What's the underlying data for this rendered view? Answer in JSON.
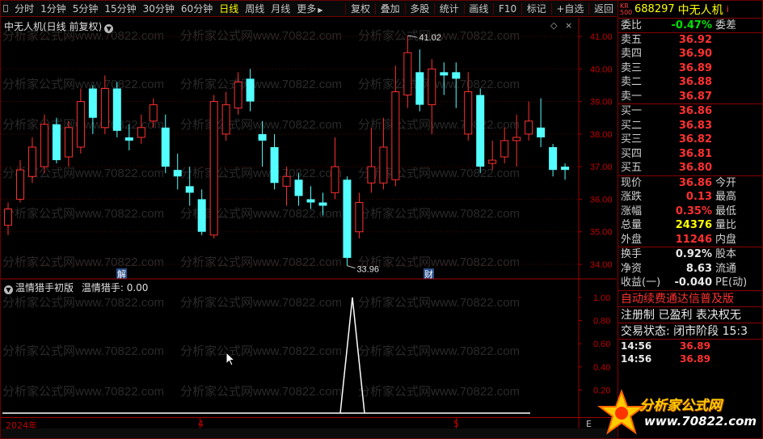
{
  "toolbar": {
    "periods": [
      "分时",
      "1分钟",
      "5分钟",
      "15分钟",
      "30分钟",
      "60分钟",
      "日线",
      "周线",
      "月线",
      "更多"
    ],
    "active_period": "日线",
    "more_icon": "triangle-right-icon",
    "actions": [
      "复权",
      "叠加",
      "多股",
      "统计",
      "画线",
      "F10",
      "标记",
      "+自选",
      "返回"
    ]
  },
  "main_chart": {
    "title": "中无人机(日线 前复权)",
    "high_label": "41.02",
    "low_label": "33.96",
    "price_ticks": [
      "41.00",
      "40.00",
      "39.00",
      "38.00",
      "37.00",
      "36.00",
      "35.00",
      "34.00"
    ],
    "markers": [
      "解",
      "财"
    ],
    "watermark": "分析家公式网www.70822.com"
  },
  "indicator": {
    "title": "温情猎手初版",
    "series_label": "温情猎手:",
    "series_value": "0.00",
    "ticks": [
      "1.00",
      "0.80",
      "0.60",
      "0.40",
      "0.20"
    ]
  },
  "time_axis": {
    "labels": [
      "2024年",
      "4",
      "5"
    ],
    "end_label": "E"
  },
  "quote": {
    "exchange_badge": "KR\n500",
    "code": "688297",
    "name": "中无人机",
    "info_icon": "i",
    "weibi": {
      "label": "委比",
      "value": "-0.47%",
      "label2": "委差"
    },
    "asks": [
      {
        "label": "卖五",
        "price": "36.92"
      },
      {
        "label": "卖四",
        "price": "36.90"
      },
      {
        "label": "卖三",
        "price": "36.89"
      },
      {
        "label": "卖二",
        "price": "36.88"
      },
      {
        "label": "卖一",
        "price": "36.87"
      }
    ],
    "bids": [
      {
        "label": "买一",
        "price": "36.86"
      },
      {
        "label": "买二",
        "price": "36.83"
      },
      {
        "label": "买三",
        "price": "36.82"
      },
      {
        "label": "买四",
        "price": "36.81"
      },
      {
        "label": "买五",
        "price": "36.80"
      }
    ],
    "stats": [
      {
        "label": "现价",
        "value": "36.86",
        "label2": "今开"
      },
      {
        "label": "涨跌",
        "value": "0.13",
        "label2": "最高"
      },
      {
        "label": "涨幅",
        "value": "0.35%",
        "label2": "最低"
      },
      {
        "label": "总量",
        "value": "24376",
        "label2": "量比"
      },
      {
        "label": "外盘",
        "value": "11246",
        "label2": "内盘"
      }
    ],
    "stats2": [
      {
        "label": "换手",
        "value": "0.92%",
        "label2": "股本"
      },
      {
        "label": "净资",
        "value": "8.63",
        "label2": "流通"
      },
      {
        "label": "收益(一)",
        "value": "-0.040",
        "label2": "PE(动)"
      }
    ],
    "promo1": "自动续费通达信普及版",
    "promo2": "注册制 已盈利 表决权无",
    "promo3": "交易状态: 闭市阶段 15:3",
    "ticks": [
      {
        "time": "14:56",
        "price": "36.89"
      },
      {
        "time": "14:56",
        "price": "36.89"
      }
    ]
  },
  "logo": {
    "text": "分析家公式网",
    "url": "www.70822.com"
  },
  "colors": {
    "up": "#ff3030",
    "down": "#54ffff",
    "axis": "#a00000",
    "background": "#000000"
  },
  "chart_data": {
    "type": "candlestick",
    "candles": [
      {
        "o": 35.2,
        "c": 35.7,
        "h": 35.9,
        "l": 34.9
      },
      {
        "o": 36.0,
        "c": 36.9,
        "h": 37.2,
        "l": 35.9
      },
      {
        "o": 36.7,
        "c": 37.6,
        "h": 37.9,
        "l": 36.5
      },
      {
        "o": 37.0,
        "c": 38.3,
        "h": 38.6,
        "l": 36.8
      },
      {
        "o": 38.3,
        "c": 37.2,
        "h": 38.5,
        "l": 37.1
      },
      {
        "o": 37.3,
        "c": 38.2,
        "h": 38.4,
        "l": 37.0
      },
      {
        "o": 37.6,
        "c": 39.0,
        "h": 39.4,
        "l": 37.4
      },
      {
        "o": 39.4,
        "c": 38.5,
        "h": 39.5,
        "l": 38.0
      },
      {
        "o": 38.2,
        "c": 39.4,
        "h": 39.8,
        "l": 38.0
      },
      {
        "o": 39.4,
        "c": 38.1,
        "h": 39.6,
        "l": 37.9
      },
      {
        "o": 37.9,
        "c": 37.8,
        "h": 38.3,
        "l": 37.5
      },
      {
        "o": 37.9,
        "c": 38.2,
        "h": 38.6,
        "l": 37.7
      },
      {
        "o": 38.4,
        "c": 38.9,
        "h": 39.1,
        "l": 38.2
      },
      {
        "o": 38.2,
        "c": 37.0,
        "h": 38.6,
        "l": 36.8
      },
      {
        "o": 36.9,
        "c": 36.7,
        "h": 37.4,
        "l": 36.3
      },
      {
        "o": 36.4,
        "c": 36.2,
        "h": 37.0,
        "l": 35.8
      },
      {
        "o": 36.0,
        "c": 35.0,
        "h": 36.3,
        "l": 34.9
      },
      {
        "o": 34.9,
        "c": 39.0,
        "h": 39.2,
        "l": 34.8
      },
      {
        "o": 38.0,
        "c": 38.9,
        "h": 39.3,
        "l": 37.8
      },
      {
        "o": 38.8,
        "c": 39.6,
        "h": 39.9,
        "l": 38.6
      },
      {
        "o": 39.7,
        "c": 39.0,
        "h": 40.0,
        "l": 38.7
      },
      {
        "o": 38.0,
        "c": 37.8,
        "h": 38.4,
        "l": 37.0
      },
      {
        "o": 37.6,
        "c": 36.5,
        "h": 38.0,
        "l": 36.3
      },
      {
        "o": 36.4,
        "c": 36.7,
        "h": 37.0,
        "l": 35.8
      },
      {
        "o": 36.6,
        "c": 36.1,
        "h": 36.8,
        "l": 35.8
      },
      {
        "o": 36.0,
        "c": 35.9,
        "h": 36.4,
        "l": 35.7
      },
      {
        "o": 35.9,
        "c": 35.8,
        "h": 36.2,
        "l": 35.5
      },
      {
        "o": 36.2,
        "c": 37.0,
        "h": 37.9,
        "l": 36.0
      },
      {
        "o": 36.6,
        "c": 34.2,
        "h": 36.7,
        "l": 33.96
      },
      {
        "o": 35.0,
        "c": 35.9,
        "h": 36.2,
        "l": 34.8
      },
      {
        "o": 36.5,
        "c": 37.0,
        "h": 38.2,
        "l": 36.2
      },
      {
        "o": 36.5,
        "c": 37.6,
        "h": 38.5,
        "l": 36.3
      },
      {
        "o": 36.6,
        "c": 39.3,
        "h": 40.1,
        "l": 36.4
      },
      {
        "o": 39.2,
        "c": 40.5,
        "h": 41.02,
        "l": 38.8
      },
      {
        "o": 39.9,
        "c": 38.9,
        "h": 40.6,
        "l": 38.7
      },
      {
        "o": 38.9,
        "c": 40.0,
        "h": 40.3,
        "l": 38.0
      },
      {
        "o": 39.9,
        "c": 39.8,
        "h": 40.2,
        "l": 39.2
      },
      {
        "o": 39.9,
        "c": 39.7,
        "h": 40.2,
        "l": 38.8
      },
      {
        "o": 38.0,
        "c": 39.3,
        "h": 39.9,
        "l": 37.8
      },
      {
        "o": 39.2,
        "c": 37.0,
        "h": 39.4,
        "l": 36.8
      },
      {
        "o": 37.1,
        "c": 37.2,
        "h": 37.8,
        "l": 36.9
      },
      {
        "o": 37.3,
        "c": 37.8,
        "h": 38.2,
        "l": 37.1
      },
      {
        "o": 37.8,
        "c": 37.9,
        "h": 38.6,
        "l": 37.0
      },
      {
        "o": 38.0,
        "c": 38.4,
        "h": 39.0,
        "l": 37.8
      },
      {
        "o": 38.2,
        "c": 37.9,
        "h": 39.1,
        "l": 37.6
      },
      {
        "o": 37.6,
        "c": 36.9,
        "h": 37.7,
        "l": 36.7
      },
      {
        "o": 37.0,
        "c": 36.9,
        "h": 37.1,
        "l": 36.6
      }
    ],
    "ylim": [
      33.8,
      41.2
    ],
    "indicator_values": [
      0,
      0,
      0,
      0,
      0,
      0,
      0,
      0,
      0,
      0,
      0,
      0,
      0,
      0,
      0,
      0,
      0,
      0,
      0,
      0,
      0,
      0,
      0,
      0,
      0,
      0,
      0,
      0,
      0,
      0,
      0,
      0,
      0,
      0,
      0,
      1,
      0,
      0,
      0,
      0,
      0,
      0,
      0,
      0,
      0,
      0,
      0
    ],
    "indicator_ylim": [
      0,
      1.1
    ]
  }
}
